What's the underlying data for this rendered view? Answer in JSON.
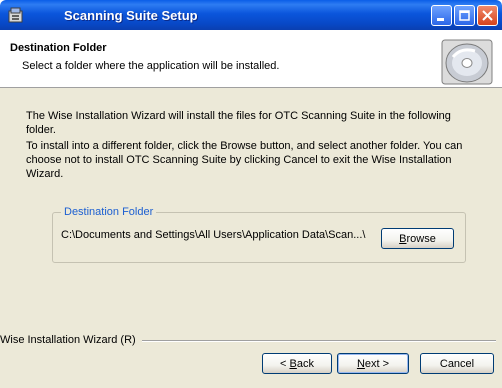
{
  "window": {
    "title": "Scanning Suite Setup",
    "icons": {
      "app": "installer-icon",
      "minimize": "minimize-icon",
      "maximize": "maximize-icon",
      "close": "close-icon"
    }
  },
  "header": {
    "title": "Destination Folder",
    "subtitle": "Select a folder where the application will be installed.",
    "icon": "cd-disc-icon"
  },
  "body": {
    "paragraph1": "The Wise Installation Wizard will install the files for OTC Scanning Suite in the following folder.",
    "paragraph2": "To install into a different folder, click the Browse button, and select another folder. You can choose not to install OTC Scanning Suite by clicking Cancel to exit the Wise Installation Wizard."
  },
  "destination": {
    "group_label": "Destination Folder",
    "path": "C:\\Documents and Settings\\All Users\\Application Data\\Scan...\\",
    "browse_label_accel": "B",
    "browse_label_rest": "rowse"
  },
  "footer": {
    "label": "Wise Installation Wizard (R)",
    "back_prefix": "< ",
    "back_accel": "B",
    "back_rest": "ack",
    "next_accel": "N",
    "next_rest": "ext >",
    "cancel_label": "Cancel"
  },
  "colors": {
    "titlebar": "#0a56dc",
    "dialog_bg": "#ece9d8",
    "group_label": "#1c5fd1"
  }
}
